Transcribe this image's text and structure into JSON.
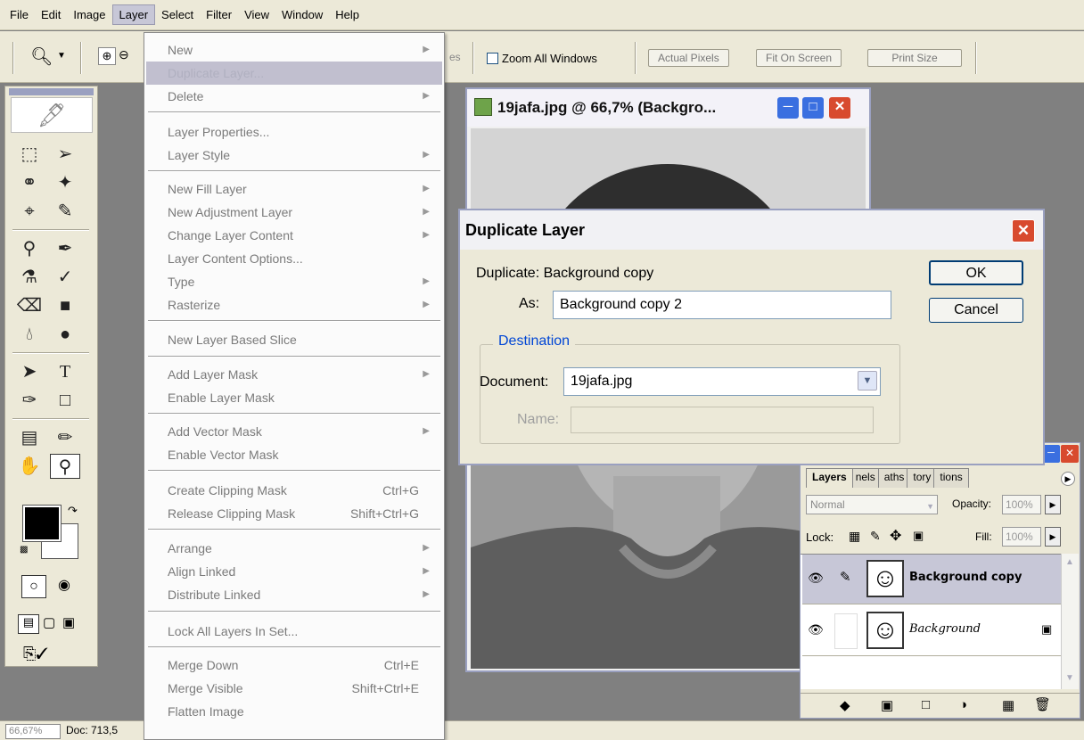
{
  "menubar": {
    "items": [
      "File",
      "Edit",
      "Image",
      "Layer",
      "Select",
      "Filter",
      "View",
      "Window",
      "Help"
    ],
    "active_index": 3
  },
  "optionsbar": {
    "truncated_label": "es",
    "zoom_all_windows": "Zoom All Windows",
    "actual_pixels": "Actual Pixels",
    "fit_on_screen": "Fit On Screen",
    "print_size": "Print Size"
  },
  "layer_menu": {
    "items": [
      {
        "label": "New",
        "submenu": true
      },
      {
        "label": "Duplicate Layer...",
        "highlighted": true
      },
      {
        "label": "Delete",
        "submenu": true
      },
      {
        "label": "Layer Properties..."
      },
      {
        "label": "Layer Style",
        "submenu": true
      },
      {
        "label": "New Fill Layer",
        "submenu": true
      },
      {
        "label": "New Adjustment Layer",
        "submenu": true
      },
      {
        "label": "Change Layer Content",
        "submenu": true
      },
      {
        "label": "Layer Content Options..."
      },
      {
        "label": "Type",
        "submenu": true
      },
      {
        "label": "Rasterize",
        "submenu": true
      },
      {
        "label": "New Layer Based Slice"
      },
      {
        "label": "Add Layer Mask",
        "submenu": true
      },
      {
        "label": "Enable Layer Mask"
      },
      {
        "label": "Add Vector Mask",
        "submenu": true
      },
      {
        "label": "Enable Vector Mask"
      },
      {
        "label": "Create Clipping Mask",
        "shortcut": "Ctrl+G"
      },
      {
        "label": "Release Clipping Mask",
        "shortcut": "Shift+Ctrl+G"
      },
      {
        "label": "Arrange",
        "submenu": true
      },
      {
        "label": "Align Linked",
        "submenu": true
      },
      {
        "label": "Distribute Linked",
        "submenu": true
      },
      {
        "label": "Lock All Layers In Set..."
      },
      {
        "label": "Merge Down",
        "shortcut": "Ctrl+E"
      },
      {
        "label": "Merge Visible",
        "shortcut": "Shift+Ctrl+E"
      },
      {
        "label": "Flatten Image"
      }
    ]
  },
  "document_window": {
    "title": "19jafa.jpg @ 66,7% (Backgro..."
  },
  "dialog": {
    "title": "Duplicate Layer",
    "duplicate_label": "Duplicate: Background copy",
    "as_label": "As:",
    "as_value": "Background copy 2",
    "ok_label": "OK",
    "cancel_label": "Cancel",
    "destination_label": "Destination",
    "document_label": "Document:",
    "document_value": "19jafa.jpg",
    "name_label": "Name:",
    "name_value": ""
  },
  "layers_palette": {
    "tabs": [
      "Layers",
      "nels",
      "aths",
      "tory",
      "tions"
    ],
    "blend_mode": "Normal",
    "opacity_label": "Opacity:",
    "opacity_value": "100%",
    "lock_label": "Lock:",
    "fill_label": "Fill:",
    "fill_value": "100%",
    "layers": [
      {
        "name": "Background copy",
        "selected": true
      },
      {
        "name": "Background",
        "selected": false,
        "locked": true
      }
    ]
  },
  "statusbar": {
    "zoom": "66,67%",
    "doc_info": "Doc: 713,5"
  },
  "colors": {
    "menu_highlight": "#c1bfcf",
    "close_red": "#d84a2e",
    "destination_blue": "#0046d5"
  }
}
